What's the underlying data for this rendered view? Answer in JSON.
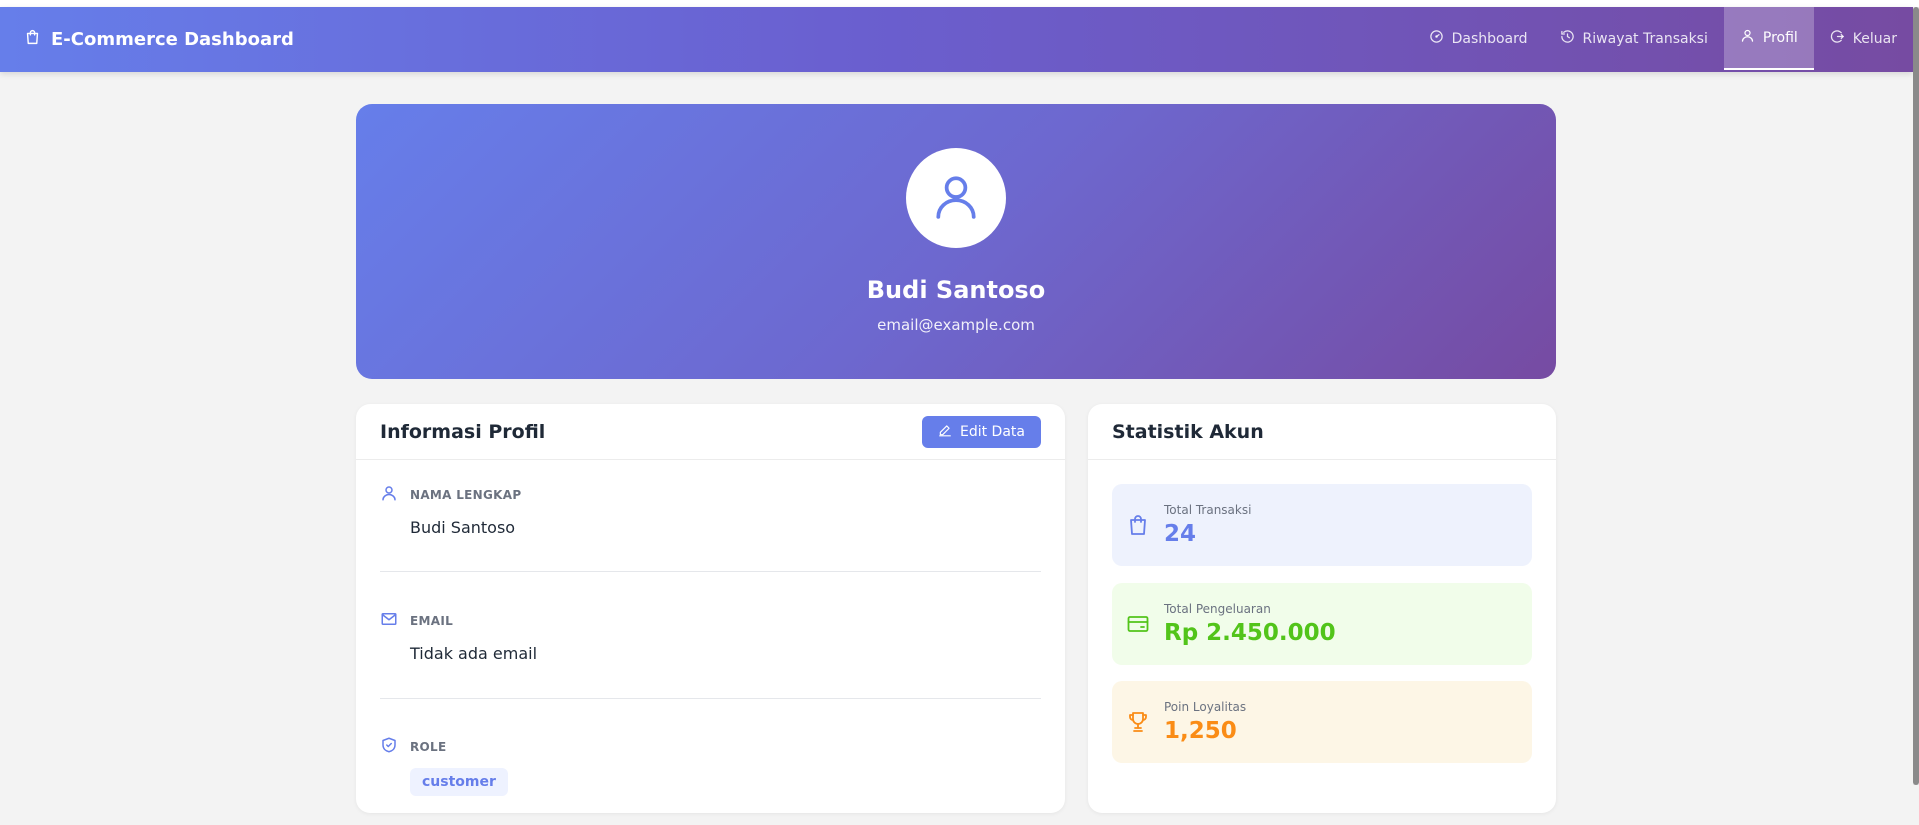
{
  "navbar": {
    "brand": "E-Commerce Dashboard",
    "items": [
      {
        "label": "Dashboard",
        "icon": "gauge-icon",
        "active": false
      },
      {
        "label": "Riwayat Transaksi",
        "icon": "history-icon",
        "active": false
      },
      {
        "label": "Profil",
        "icon": "user-icon",
        "active": true
      },
      {
        "label": "Keluar",
        "icon": "logout-icon",
        "active": false
      }
    ]
  },
  "hero": {
    "name": "Budi Santoso",
    "email": "email@example.com"
  },
  "profile_card": {
    "title": "Informasi Profil",
    "edit_label": "Edit Data",
    "fields": {
      "name": {
        "label": "NAMA LENGKAP",
        "value": "Budi Santoso"
      },
      "email": {
        "label": "EMAIL",
        "value": "Tidak ada email"
      },
      "role": {
        "label": "ROLE",
        "value": "customer"
      }
    }
  },
  "stats_card": {
    "title": "Statistik Akun",
    "stats": [
      {
        "label": "Total Transaksi",
        "value": "24",
        "icon": "shopping-bag-icon",
        "color": "#667eea"
      },
      {
        "label": "Total Pengeluaran",
        "value": "Rp 2.450.000",
        "icon": "credit-card-icon",
        "color": "#52c41a"
      },
      {
        "label": "Poin Loyalitas",
        "value": "1,250",
        "icon": "trophy-icon",
        "color": "#fa8c16"
      }
    ]
  },
  "colors": {
    "primary": "#667eea",
    "secondary": "#764ba2",
    "background": "#f3f3f3"
  }
}
